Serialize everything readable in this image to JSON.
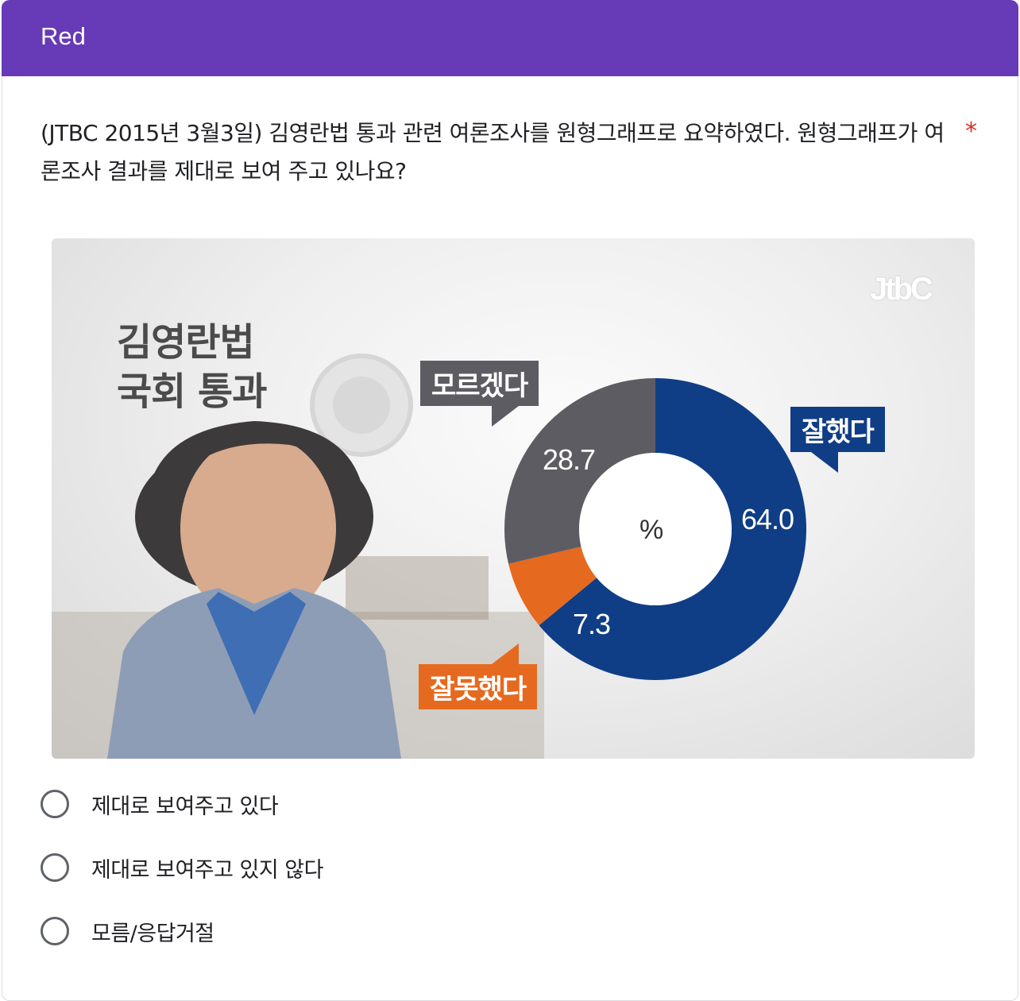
{
  "form": {
    "section_title": "Red",
    "question_text": "(JTBC 2015년 3월3일) 김영란법 통과 관련 여론조사를 원형그래프로 요약하였다. 원형그래프가 여론조사 결과를 제대로 보여 주고 있나요?",
    "required_marker": "*"
  },
  "image": {
    "headline_line1": "김영란법",
    "headline_line2": "국회 통과",
    "logo": "JtbC",
    "tag_gray": "모르겠다",
    "tag_blue": "잘했다",
    "tag_orange": "잘못했다",
    "center_label": "%",
    "colors": {
      "blue": "#0f3e86",
      "orange": "#e56a1f",
      "gray": "#5e5c63"
    }
  },
  "chart_data": {
    "type": "pie",
    "categories": [
      "잘했다",
      "잘못했다",
      "모르겠다"
    ],
    "values": [
      64.0,
      7.3,
      28.7
    ],
    "value_labels": [
      "64.0",
      "7.3",
      "28.7"
    ],
    "colors": [
      "#0f3e86",
      "#e56a1f",
      "#5e5c63"
    ],
    "center_label": "%"
  },
  "options": [
    {
      "label": "제대로 보여주고 있다"
    },
    {
      "label": "제대로 보여주고 있지 않다"
    },
    {
      "label": "모름/응답거절"
    }
  ]
}
